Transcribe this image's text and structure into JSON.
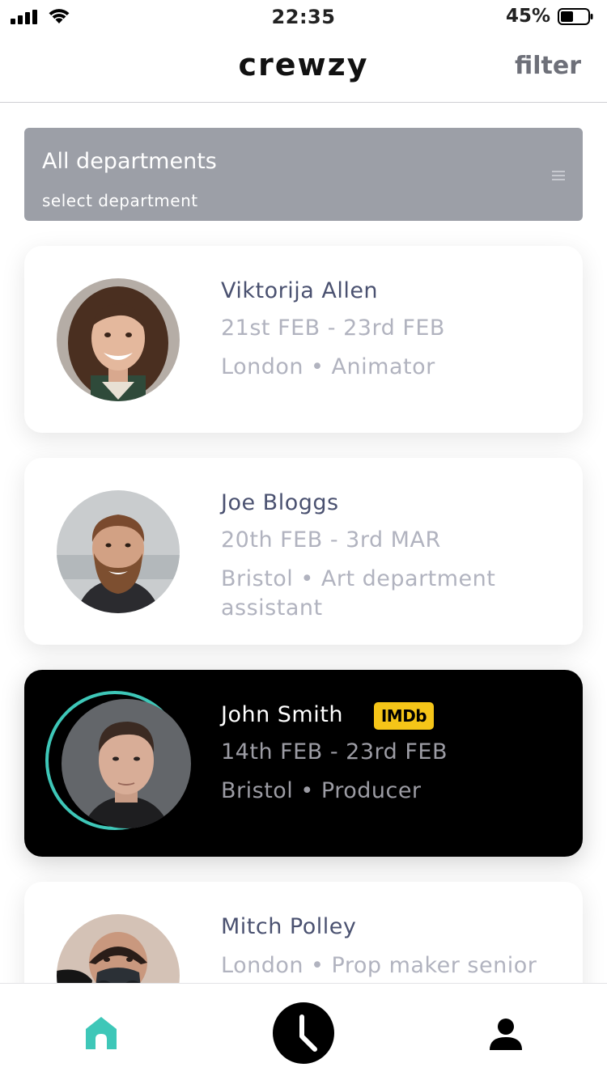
{
  "status": {
    "time": "22:35",
    "battery": "45%"
  },
  "header": {
    "logo": "crewzy",
    "filter_label": "filter"
  },
  "department": {
    "title": "All departments",
    "subtitle": "select department"
  },
  "people": [
    {
      "name": "Viktorija Allen",
      "dates": "21st FEB - 23rd FEB",
      "details": "London • Animator"
    },
    {
      "name": "Joe Bloggs",
      "dates": "20th FEB - 3rd MAR",
      "details": "Bristol • Art department assistant"
    },
    {
      "name": "John Smith",
      "dates": "14th FEB - 23rd FEB",
      "details": "Bristol • Producer",
      "badge": "IMDb",
      "selected": true
    },
    {
      "name": "Mitch Polley",
      "details": "London • Prop maker senior"
    }
  ],
  "tabs": [
    {
      "icon": "home-icon",
      "active": true
    },
    {
      "icon": "clock-icon"
    },
    {
      "icon": "profile-icon"
    }
  ],
  "colors": {
    "accent": "#3ec7b8",
    "imdb": "#f5c518",
    "dept_bg": "#9c9fa7",
    "name_text": "#4a5170",
    "sub_text": "#b1b3bf"
  }
}
